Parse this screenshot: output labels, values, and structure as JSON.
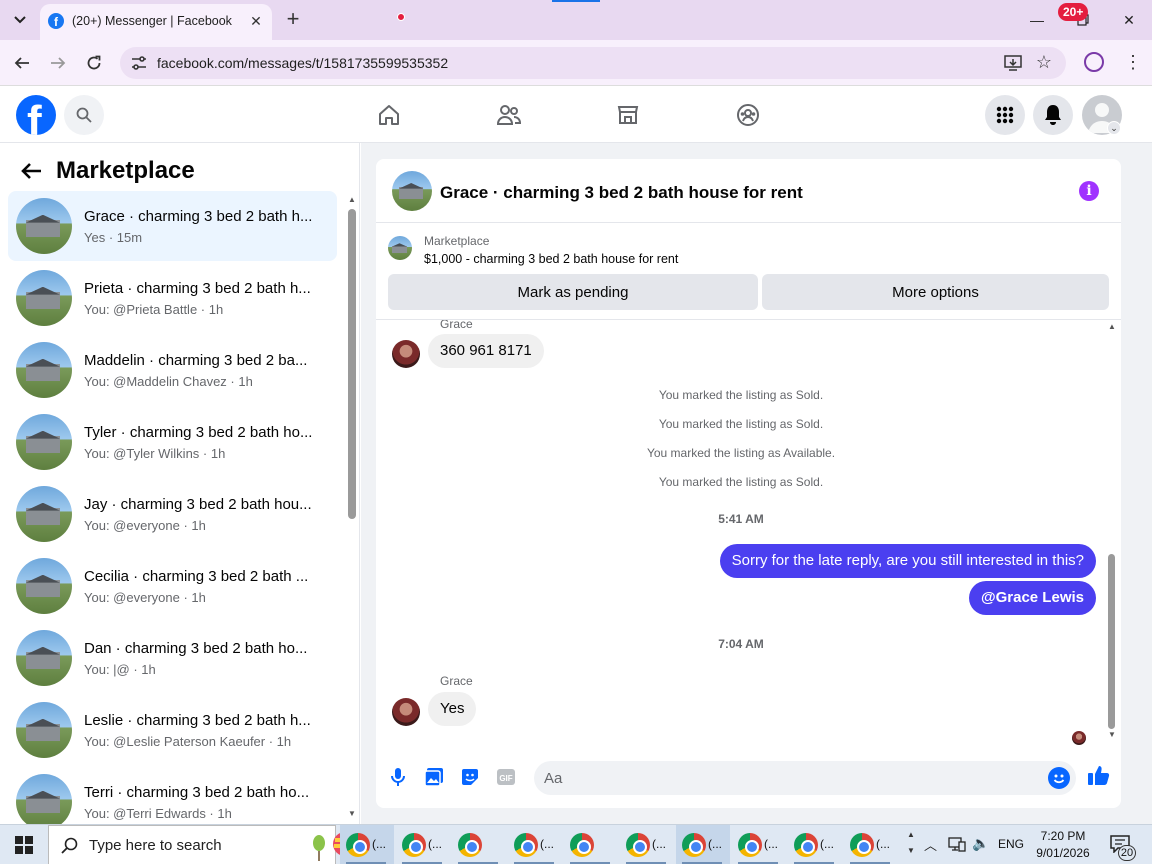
{
  "browser": {
    "tab_title": "(20+) Messenger | Facebook",
    "url": "facebook.com/messages/t/1581735599535352"
  },
  "fb_header": {
    "notification_badge": "20+"
  },
  "left_panel": {
    "title": "Marketplace",
    "conversations": [
      {
        "name": "Grace · charming 3 bed 2 bath h...",
        "sub": "Yes · 15m",
        "active": true
      },
      {
        "name": "Prieta · charming 3 bed 2 bath h...",
        "sub": "You: @Prieta Battle · 1h"
      },
      {
        "name": "Maddelin · charming 3 bed 2 ba...",
        "sub": "You: @Maddelin Chavez · 1h"
      },
      {
        "name": "Tyler · charming 3 bed 2 bath ho...",
        "sub": "You: @Tyler Wilkins · 1h"
      },
      {
        "name": "Jay · charming 3 bed 2 bath hou...",
        "sub": "You: @everyone · 1h"
      },
      {
        "name": "Cecilia · charming 3 bed 2 bath ...",
        "sub": "You: @everyone · 1h"
      },
      {
        "name": "Dan · charming 3 bed 2 bath ho...",
        "sub": "You: |@ · 1h"
      },
      {
        "name": "Leslie · charming 3 bed 2 bath h...",
        "sub": "You: @Leslie Paterson Kaeufer · 1h"
      },
      {
        "name": "Terri · charming 3 bed 2 bath ho...",
        "sub": "You: @Terri Edwards · 1h"
      }
    ]
  },
  "chat": {
    "title": "Grace · charming 3 bed 2 bath house for rent",
    "listing_source": "Marketplace",
    "listing_desc": "$1,000 - charming 3 bed 2 bath house for rent",
    "mark_pending_label": "Mark as pending",
    "more_options_label": "More options",
    "messages": {
      "sender_1": "Grace",
      "phone_msg": "360 961 8171",
      "sys_1": "You marked the listing as Sold.",
      "sys_2": "You marked the listing as Sold.",
      "sys_3": "You marked the listing as Available.",
      "sys_4": "You marked the listing as Sold.",
      "time_1": "5:41 AM",
      "out_1": "Sorry for the late reply, are you still interested in this?",
      "out_2": "@Grace Lewis",
      "time_2": "7:04 AM",
      "sender_2": "Grace",
      "in_2": "Yes"
    },
    "composer_placeholder": "Aa"
  },
  "taskbar": {
    "search_placeholder": "Type here to search",
    "app_label": "(...",
    "lang": "ENG",
    "time": "7:20 PM",
    "date": "9/01/2026",
    "notif_count": "20"
  },
  "colors": {
    "fb_blue": "#0866ff",
    "outgoing_bubble": "#4b3ff0",
    "badge_red": "#e41e3f",
    "info_purple": "#a033ff"
  }
}
